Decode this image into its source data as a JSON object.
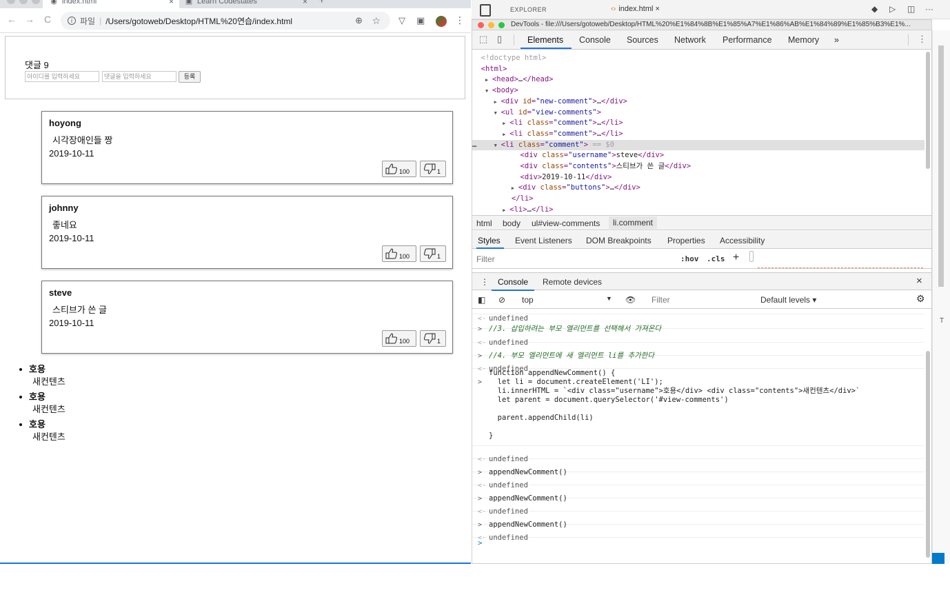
{
  "browser": {
    "tabs": [
      {
        "title": "index.html",
        "close": "×"
      },
      {
        "title": "Learn Codestates",
        "close": "×"
      }
    ],
    "new_tab": "+",
    "nav": {
      "back": "←",
      "forward": "→",
      "reload": "C"
    },
    "address": {
      "info": "i",
      "scheme": "파일",
      "url": "/Users/gotoweb/Desktop/HTML%20연습/index.html",
      "zoom": "⊕",
      "star": "☆"
    },
    "menu": "⋮"
  },
  "page": {
    "comment_count": "댓글 9",
    "id_placeholder": "아이디를 입력하세요",
    "comment_placeholder": "댓글을 입력하세요",
    "submit_label": "등록",
    "comments": [
      {
        "username": "hoyong",
        "contents": "시각장애인들 짱",
        "date": "2019-10-11",
        "likes": "100",
        "dislikes": "1"
      },
      {
        "username": "johnny",
        "contents": "좋네요",
        "date": "2019-10-11",
        "likes": "100",
        "dislikes": "1"
      },
      {
        "username": "steve",
        "contents": "스티브가 쓴 글",
        "date": "2019-10-11",
        "likes": "100",
        "dislikes": "1"
      }
    ],
    "added_items": [
      {
        "username": "호용",
        "contents": "새컨텐츠"
      },
      {
        "username": "호용",
        "contents": "새컨텐츠"
      },
      {
        "username": "호용",
        "contents": "새컨텐츠"
      }
    ]
  },
  "vscode": {
    "explorer_label": "EXPLORER",
    "file_tab": "index.html",
    "file_tab_close": "×",
    "more": "···"
  },
  "devtools": {
    "window_title": "DevTools - file:///Users/gotoweb/Desktop/HTML%20%E1%84%8B%E1%85%A7%E1%86%AB%E1%84%89%E1%85%B3%E1%...",
    "panel_tabs": [
      "Elements",
      "Console",
      "Sources",
      "Network",
      "Performance",
      "Memory",
      "»"
    ],
    "breadcrumbs": [
      "html",
      "body",
      "ul#view-comments",
      "li.comment"
    ],
    "styles_tabs": [
      "Styles",
      "Event Listeners",
      "DOM Breakpoints",
      "Properties",
      "Accessibility"
    ],
    "styles_filter_placeholder": "Filter",
    "hov": ":hov",
    "cls": ".cls",
    "plus": "+",
    "drawer_tabs": [
      "Console",
      "Remote devices"
    ],
    "drawer_close": "×",
    "context": "top",
    "console_filter_placeholder": "Filter",
    "levels": "Default levels ▾",
    "tree_selected_suffix": "== $0",
    "console": {
      "undefined": "undefined",
      "comment3": "//3. 삽입하려는 부모 엘리먼트를 선택해서 가져온다",
      "comment4": "//4. 부모 엘리먼트에 새 엘리먼트 li를 추가한다",
      "fn_lines": [
        "function appendNewComment() {",
        "  let li = document.createElement('LI');",
        "  li.innerHTML = `<div class=\"username\">호용</div> <div class=\"contents\">새컨텐츠</div>`",
        "  let parent = document.querySelector('#view-comments')",
        "",
        "  parent.appendChild(li)",
        "",
        "}"
      ],
      "call": "appendNewComment()"
    }
  },
  "colors": {
    "accent": "#1a73e8",
    "tag": "#881280",
    "attr": "#994500",
    "attr_value": "#1a1aa6"
  }
}
